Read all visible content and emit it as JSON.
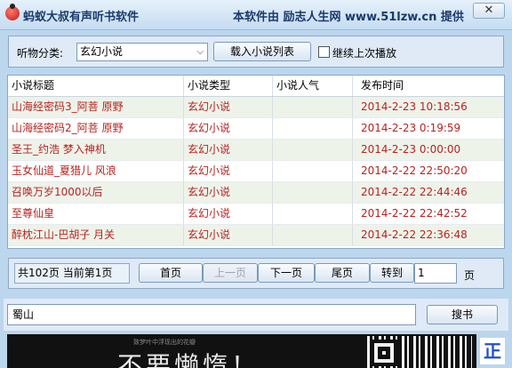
{
  "window": {
    "title": "蚂蚁大叔有声听书软件",
    "provider": "本软件由 励志人生网 www.51lzw.cn 提供",
    "close_label": "✕"
  },
  "toolbar": {
    "category_label": "听物分类:",
    "category_value": "玄幻小说",
    "load_button": "载入小说列表",
    "continue_label": "继续上次播放",
    "continue_checked": false
  },
  "table": {
    "headers": [
      "小说标题",
      "小说类型",
      "小说人气",
      "发布时间"
    ],
    "rows": [
      {
        "title": "山海经密码3_阿菩 原野",
        "type": "玄幻小说",
        "popularity": "",
        "time": "2014-2-23 10:18:56"
      },
      {
        "title": "山海经密码2_阿菩 原野",
        "type": "玄幻小说",
        "popularity": "",
        "time": "2014-2-23 0:19:59"
      },
      {
        "title": "圣王_约浩 梦入神机",
        "type": "玄幻小说",
        "popularity": "",
        "time": "2014-2-23 0:00:00"
      },
      {
        "title": "玉女仙道_夏猎儿 风浪",
        "type": "玄幻小说",
        "popularity": "",
        "time": "2014-2-22 22:50:20"
      },
      {
        "title": "召唤万岁1000以后",
        "type": "玄幻小说",
        "popularity": "",
        "time": "2014-2-22 22:44:46"
      },
      {
        "title": "至尊仙皇",
        "type": "玄幻小说",
        "popularity": "",
        "time": "2014-2-22 22:42:52"
      },
      {
        "title": "醉枕江山-巴胡子 月关",
        "type": "玄幻小说",
        "popularity": "",
        "time": "2014-2-22 22:36:48"
      }
    ]
  },
  "pager": {
    "info": "共102页  当前第1页",
    "first": "首页",
    "prev": "上一页",
    "next": "下一页",
    "last": "尾页",
    "goto": "转到",
    "page_input": "1",
    "page_unit": "页"
  },
  "search": {
    "value": "蜀山",
    "button": "搜书"
  },
  "banner": {
    "small_text": "致梦叶中浮现出的花瓣",
    "text": "不要懒惰！",
    "side_char": "正"
  }
}
